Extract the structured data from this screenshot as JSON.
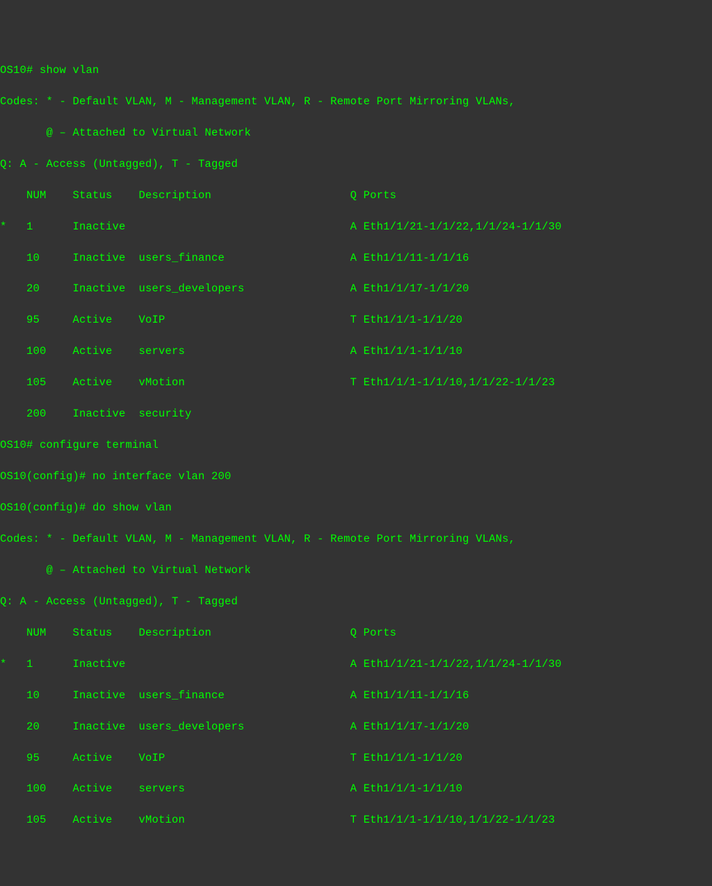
{
  "prompt1": "OS10# ",
  "cmd1": "show vlan",
  "codes_line1": "Codes: * - Default VLAN, M - Management VLAN, R - Remote Port Mirroring VLANs,",
  "codes_line2": "       @ – Attached to Virtual Network",
  "q_line": "Q: A - Access (Untagged), T - Tagged",
  "header": "    NUM    Status    Description                     Q Ports",
  "vlans1": [
    "*   1      Inactive                                  A Eth1/1/21-1/1/22,1/1/24-1/1/30",
    "    10     Inactive  users_finance                   A Eth1/1/11-1/1/16",
    "    20     Inactive  users_developers                A Eth1/1/17-1/1/20",
    "    95     Active    VoIP                            T Eth1/1/1-1/1/20",
    "    100    Active    servers                         A Eth1/1/1-1/1/10",
    "    105    Active    vMotion                         T Eth1/1/1-1/1/10,1/1/22-1/1/23",
    "    200    Inactive  security"
  ],
  "prompt2": "OS10# ",
  "cmd2": "configure terminal",
  "prompt3": "OS10(config)# ",
  "cmd3": "no interface vlan 200",
  "prompt4": "OS10(config)# ",
  "cmd4": "do show vlan",
  "vlans2": [
    "*   1      Inactive                                  A Eth1/1/21-1/1/22,1/1/24-1/1/30",
    "    10     Inactive  users_finance                   A Eth1/1/11-1/1/16",
    "    20     Inactive  users_developers                A Eth1/1/17-1/1/20",
    "    95     Active    VoIP                            T Eth1/1/1-1/1/20",
    "    100    Active    servers                         A Eth1/1/1-1/1/10",
    "    105    Active    vMotion                         T Eth1/1/1-1/1/10,1/1/22-1/1/23"
  ]
}
